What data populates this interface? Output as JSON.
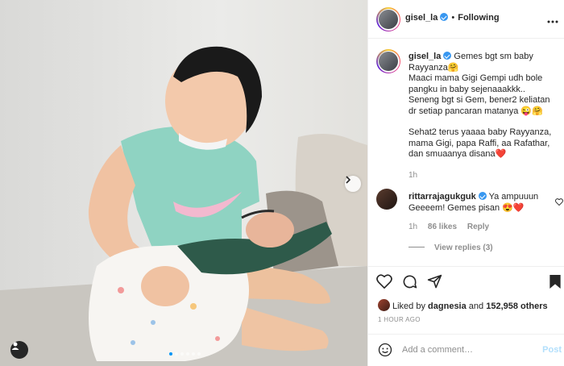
{
  "post": {
    "author": {
      "username": "gisel_la",
      "verified": true,
      "follow_separator": "•",
      "follow_status": "Following"
    },
    "photo": {
      "subject": "girl in mint shirt holding sleeping newborn",
      "carousel_dots": 6,
      "active_dot": 0
    },
    "caption": {
      "username": "gisel_la",
      "lines": [
        "Gemes bgt sm baby Rayyanza🤗",
        "Maaci mama Gigi Gempi udh bole pangku in baby sejenaaakkk..",
        "Seneng bgt si Gem, bener2 keliatan dr setiap pancaran matanya 😜🤗",
        "",
        "Sehat2 terus yaaaa baby Rayyanza, mama Gigi, papa Raffi, aa Rafathar, dan smuaanya disana❤️"
      ],
      "time": "1h"
    },
    "comment": {
      "username": "rittarrajagukguk",
      "text": "Ya ampuuun Geeeem! Gemes pisan 😍❤️",
      "time": "1h",
      "likes": "86 likes",
      "reply": "Reply",
      "view_replies": "View replies (3)"
    },
    "likes": {
      "prefix": "Liked by",
      "user": "dagnesia",
      "joiner": "and",
      "others": "152,958 others"
    },
    "timestamp": "1 HOUR AGO",
    "add_comment": {
      "placeholder": "Add a comment…",
      "post_label": "Post"
    },
    "colors": {
      "accent": "#0095f6",
      "verified": "#3897f0",
      "post_disabled": "#b2dffc",
      "muted": "#8e8e8e",
      "heart_red": "#ed4956"
    },
    "icons": [
      "more-icon",
      "next-arrow-icon",
      "user-tag-icon",
      "heart-icon",
      "comment-icon",
      "share-icon",
      "bookmark-icon",
      "emoji-icon",
      "verified-icon"
    ]
  }
}
